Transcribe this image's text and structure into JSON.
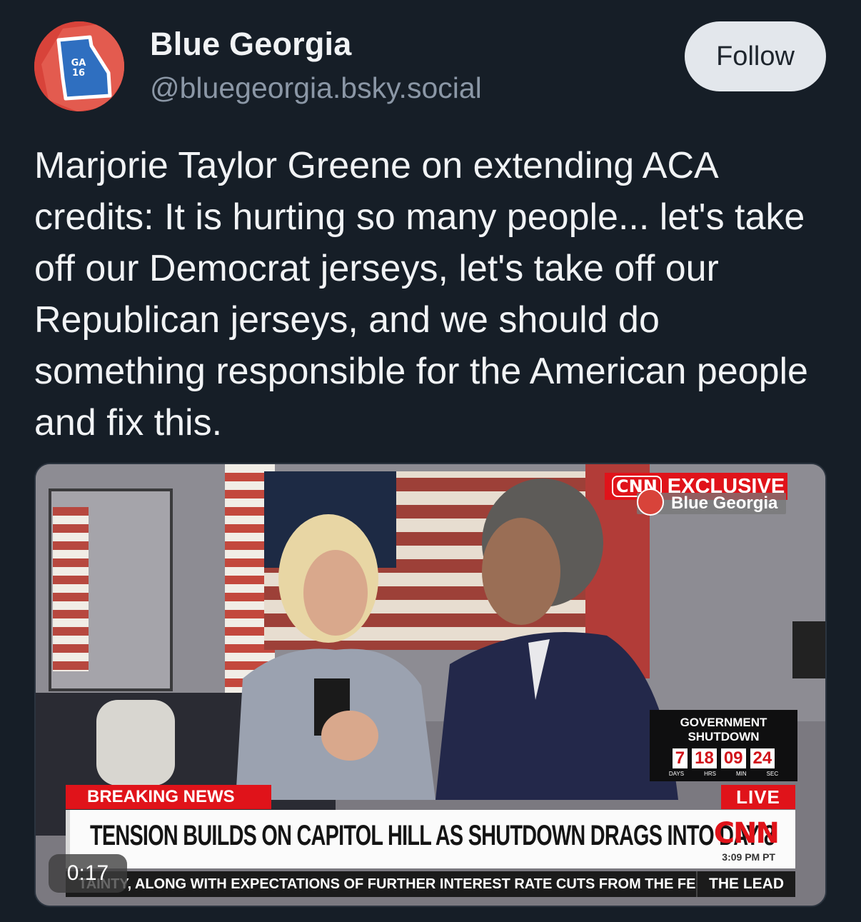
{
  "post": {
    "author": {
      "display_name": "Blue Georgia",
      "handle": "@bluegeorgia.bsky.social",
      "avatar_text_top": "GA",
      "avatar_text_bottom": "16"
    },
    "follow_label": "Follow",
    "text": "Marjorie Taylor Greene on extending  ACA credits: It is hurting so many people... let's take off our Democrat jerseys, let's take off our Republican jerseys, and we should do something responsible for the American people and fix this."
  },
  "video": {
    "timestamp": "0:17",
    "overlay": {
      "exclusive_logo": "CNN",
      "exclusive_label": "EXCLUSIVE",
      "channel_name": "Blue Georgia",
      "clock": {
        "title_line1": "GOVERNMENT",
        "title_line2": "SHUTDOWN",
        "days": "7",
        "hours": "18",
        "minutes": "09",
        "seconds": "24",
        "unit_days": "DAYS",
        "unit_hours": "HRS",
        "unit_minutes": "MIN",
        "unit_seconds": "SEC"
      },
      "breaking_label": "BREAKING NEWS",
      "live_label": "LIVE",
      "headline": "TENSION BUILDS ON CAPITOL HILL AS SHUTDOWN DRAGS INTO DAY 8",
      "network_logo": "CNN",
      "air_time": "3:09 PM PT",
      "ticker_text": "TAINTY, ALONG WITH EXPECTATIONS OF FURTHER INTEREST RATE CUTS FROM THE FEI",
      "show_name": "THE LEAD"
    }
  },
  "colors": {
    "background": "#161e27",
    "cnn_red": "#e0131a",
    "follow_button": "#e3e7ec"
  }
}
